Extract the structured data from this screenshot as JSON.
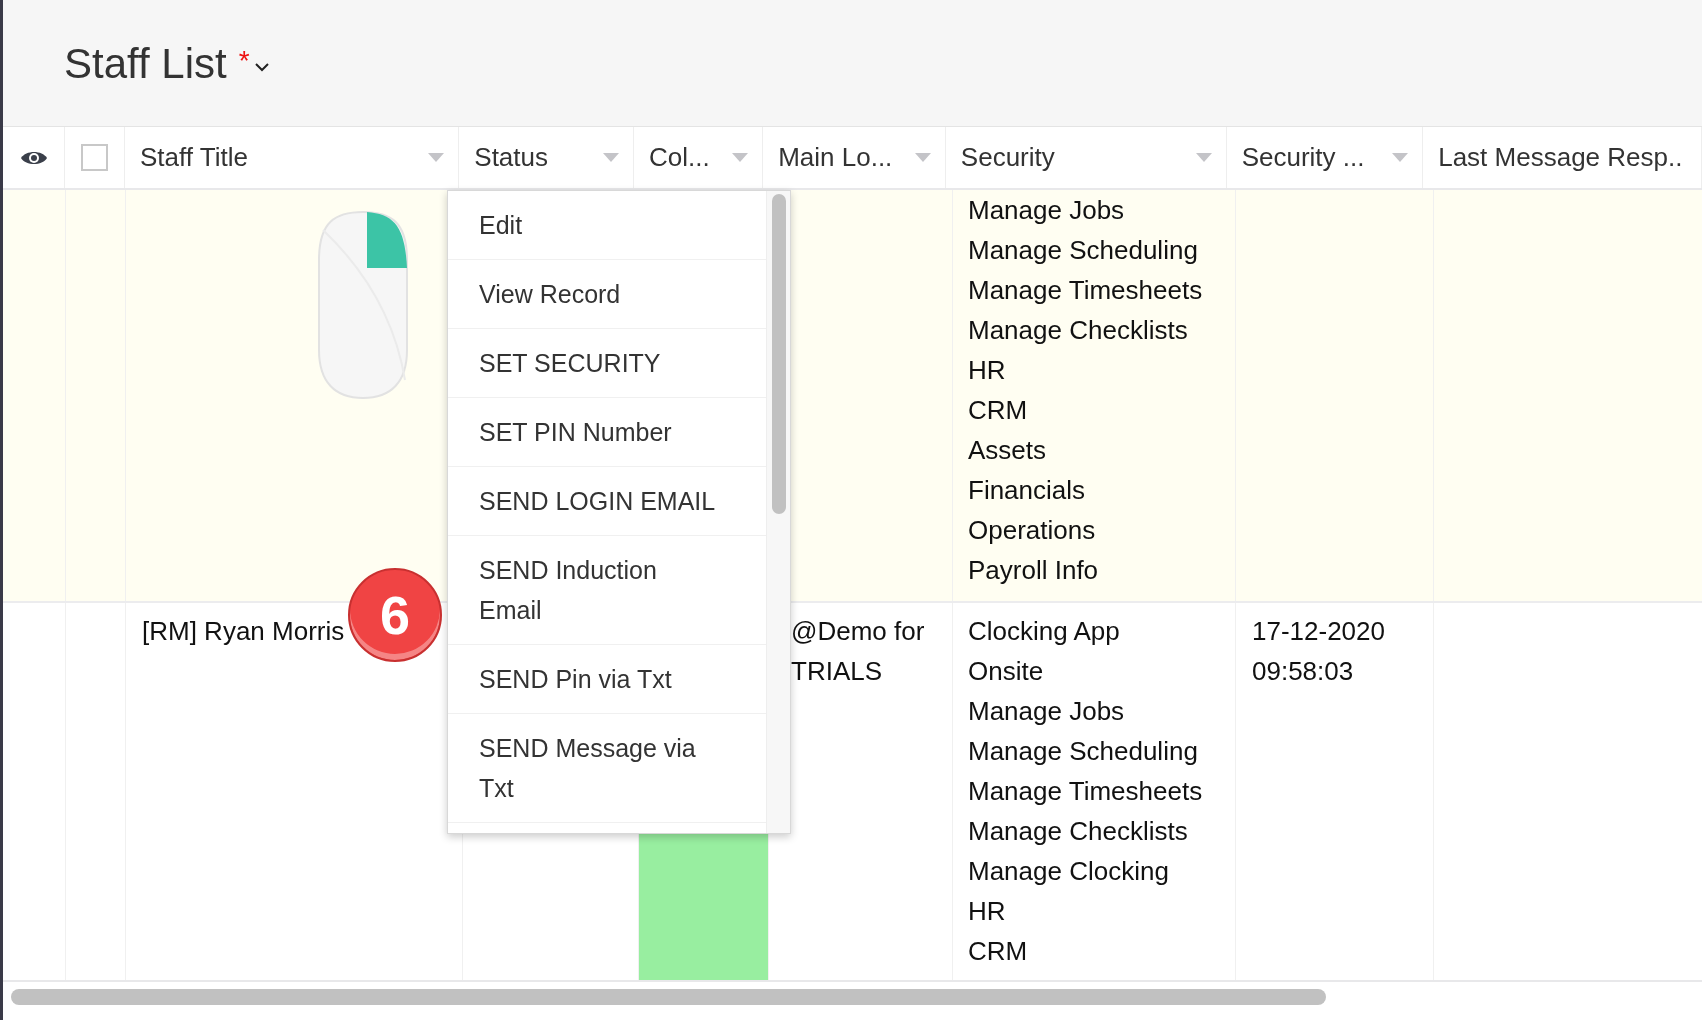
{
  "page": {
    "title": "Staff List",
    "required_mark": "*"
  },
  "columns": [
    {
      "kind": "eye"
    },
    {
      "kind": "checkbox",
      "checked": false
    },
    {
      "kind": "text",
      "label": "Staff Title"
    },
    {
      "kind": "text",
      "label": "Status"
    },
    {
      "kind": "text",
      "label": "Col..."
    },
    {
      "kind": "text",
      "label": "Main Lo..."
    },
    {
      "kind": "text",
      "label": "Security"
    },
    {
      "kind": "text",
      "label": "Security ..."
    },
    {
      "kind": "text",
      "label": "Last Message Resp.."
    }
  ],
  "rows": [
    {
      "highlighted": true,
      "has_image": true,
      "security": [
        "Manage Jobs",
        "Manage Scheduling",
        "Manage Timesheets",
        "Manage Checklists",
        "HR",
        "CRM",
        "Assets",
        "Financials",
        "Operations",
        "Payroll Info"
      ]
    },
    {
      "highlighted": false,
      "has_image": false,
      "staff_title": "[RM] Ryan Morris",
      "color": "#98eea0",
      "main_location": [
        "@Demo for",
        "TRIALS"
      ],
      "security": [
        "Clocking App",
        "Onsite",
        "Manage Jobs",
        "Manage Scheduling",
        "Manage Timesheets",
        "Manage Checklists",
        "Manage Clocking",
        "HR",
        "CRM"
      ],
      "security_2": [
        "17-12-2020",
        "09:58:03"
      ]
    }
  ],
  "context_menu": {
    "items": [
      "Edit",
      "View Record",
      "SET SECURITY",
      "SET PIN Number",
      "SEND LOGIN EMAIL",
      "SEND Induction Email",
      "SEND Pin via Txt",
      "SEND Message via Txt"
    ]
  },
  "step_badge": "6"
}
